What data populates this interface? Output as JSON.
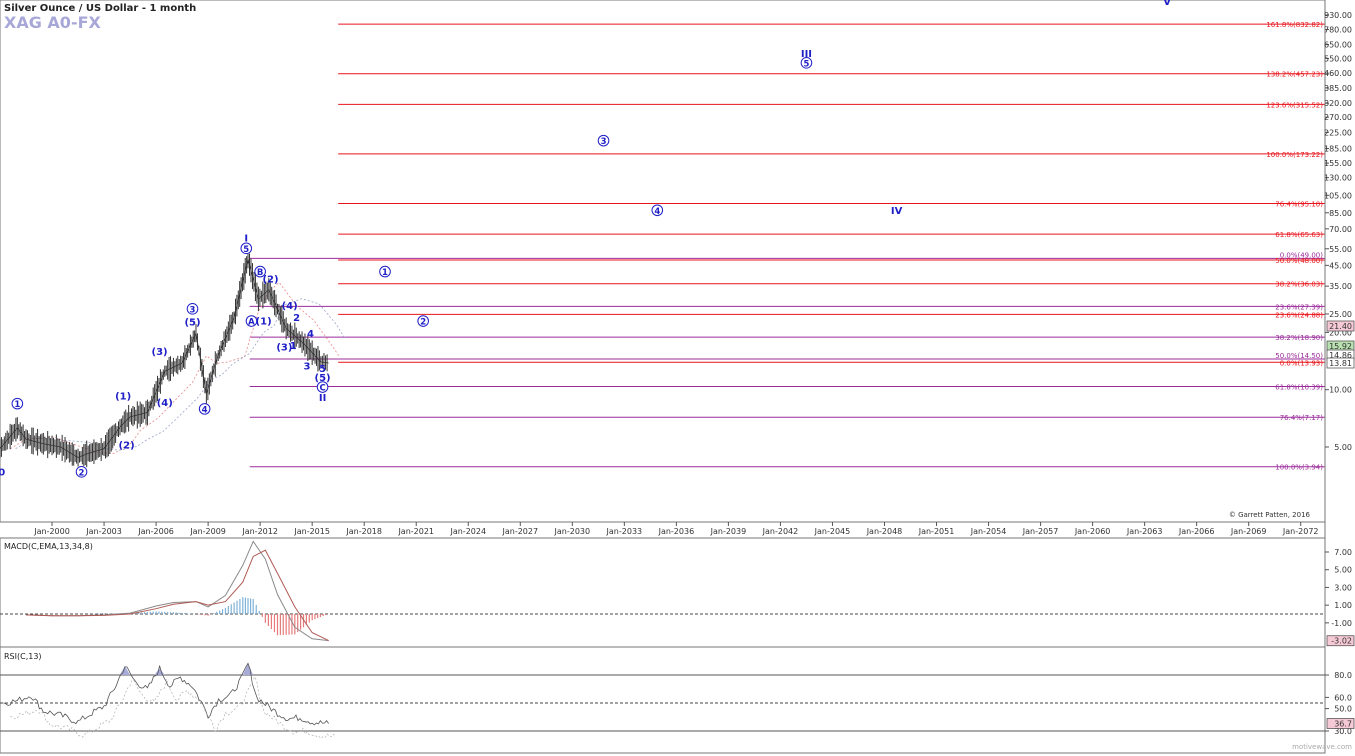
{
  "header": {
    "title": "Silver Ounce / US Dollar - 1 month",
    "symbol": "XAG A0-FX"
  },
  "copyright": "© Garrett Patten, 2016",
  "watermark": "motivewave.com",
  "colors": {
    "price": "#333333",
    "wave_label": "#1f1fc8",
    "fib_red": "#e8141b",
    "fib_purple": "#9b2b9b",
    "macd_line": "#8a8a8a",
    "signal_line": "#b05a55",
    "hist_pos": "#7fb2d8",
    "hist_neg": "#e67a7a",
    "rsi": "#555555"
  },
  "chart_data": [
    {
      "type": "line",
      "name": "price",
      "y_scale": "log",
      "y_ticks": [
        "930.00",
        "780.00",
        "650.00",
        "550.00",
        "460.00",
        "385.00",
        "320.00",
        "270.00",
        "225.00",
        "185.00",
        "155.00",
        "130.00",
        "105.00",
        "85.00",
        "70.00",
        "55.00",
        "45.00",
        "35.00",
        "25.00",
        "20.00",
        "10.00",
        "5.00"
      ],
      "x_ticks": [
        "Jan-2000",
        "Jan-2003",
        "Jan-2006",
        "Jan-2009",
        "Jan-2012",
        "Jan-2015",
        "Jan-2018",
        "Jan-2021",
        "Jan-2024",
        "Jan-2027",
        "Jan-2030",
        "Jan-2033",
        "Jan-2036",
        "Jan-2039",
        "Jan-2042",
        "Jan-2045",
        "Jan-2048",
        "Jan-2051",
        "Jan-2054",
        "Jan-2057",
        "Jan-2060",
        "Jan-2063",
        "Jan-2066",
        "Jan-2069",
        "Jan-2072"
      ],
      "price_badges": [
        {
          "label": "21.40",
          "value": 21.4,
          "style": "pink"
        },
        {
          "label": "15.92",
          "value": 15.92,
          "style": "green"
        },
        {
          "label": "14.86",
          "value": 14.86,
          "style": "white"
        },
        {
          "label": "13.81",
          "value": 13.81,
          "style": "white"
        }
      ],
      "series": [
        {
          "x": [
            1997.0,
            1998.0,
            1998.5,
            1999.5,
            2000.5,
            2001.5,
            2002.0,
            2003.0,
            2004.0,
            2004.5,
            2005.5,
            2006.5,
            2007.5,
            2008.3,
            2008.9,
            2009.5,
            2010.5,
            2011.3,
            2011.9,
            2012.5,
            2013.5,
            2014.5,
            2015.5,
            2015.95
          ],
          "values": [
            4.9,
            6.3,
            5.5,
            5.2,
            5.0,
            4.4,
            4.6,
            4.9,
            6.5,
            7.2,
            7.6,
            12.5,
            13.8,
            19.8,
            9.5,
            14.5,
            24.0,
            48.6,
            30.0,
            33.5,
            21.0,
            17.5,
            14.0,
            13.81
          ]
        }
      ],
      "fib_levels": [
        {
          "label": "161.8%(832.82)",
          "value": 832.82,
          "color": "red"
        },
        {
          "label": "138.2%(457.23)",
          "value": 457.23,
          "color": "red"
        },
        {
          "label": "123.6%(315.52)",
          "value": 315.52,
          "color": "red"
        },
        {
          "label": "100.0%(173.22)",
          "value": 173.22,
          "color": "red"
        },
        {
          "label": "76.4%(95.10)",
          "value": 95.1,
          "color": "red"
        },
        {
          "label": "61.8%(65.63)",
          "value": 65.63,
          "color": "red"
        },
        {
          "label": "0.0%(49.00)",
          "value": 49.0,
          "color": "purple"
        },
        {
          "label": "50.0%(48.00)",
          "value": 48.0,
          "color": "red"
        },
        {
          "label": "38.2%(36.03)",
          "value": 36.03,
          "color": "red"
        },
        {
          "label": "23.6%(27.39)",
          "value": 27.39,
          "color": "purple"
        },
        {
          "label": "23.6%(24.88)",
          "value": 24.88,
          "color": "red"
        },
        {
          "label": "38.2%(18.90)",
          "value": 18.9,
          "color": "purple"
        },
        {
          "label": "50.0%(14.50)",
          "value": 14.5,
          "color": "purple"
        },
        {
          "label": "0.0%(13.93)",
          "value": 13.93,
          "color": "red"
        },
        {
          "label": "61.8%(10.39)",
          "value": 10.39,
          "color": "purple"
        },
        {
          "label": "76.4%(7.17)",
          "value": 7.17,
          "color": "purple"
        },
        {
          "label": "100.0%(3.94)",
          "value": 3.94,
          "color": "purple"
        }
      ],
      "wave_labels": [
        {
          "text": "0",
          "x": 1997.1,
          "y": 3.55,
          "circle": false
        },
        {
          "text": "1",
          "x": 1998.0,
          "y": 8.1,
          "circle": true
        },
        {
          "text": "2",
          "x": 2001.7,
          "y": 3.55,
          "circle": true
        },
        {
          "text": "(1)",
          "x": 2004.1,
          "y": 8.9,
          "circle": false
        },
        {
          "text": "(2)",
          "x": 2004.3,
          "y": 4.9,
          "circle": false
        },
        {
          "text": "(3)",
          "x": 2006.2,
          "y": 15.2,
          "circle": false
        },
        {
          "text": "(4)",
          "x": 2006.5,
          "y": 8.2,
          "circle": false
        },
        {
          "text": "3",
          "x": 2008.1,
          "y": 25.5,
          "circle": true
        },
        {
          "text": "(5)",
          "x": 2008.1,
          "y": 21.8,
          "circle": false
        },
        {
          "text": "4",
          "x": 2008.8,
          "y": 7.6,
          "circle": true
        },
        {
          "text": "I",
          "x": 2011.2,
          "y": 60.0,
          "circle": false
        },
        {
          "text": "5",
          "x": 2011.2,
          "y": 53.0,
          "circle": true
        },
        {
          "text": "B",
          "x": 2012.0,
          "y": 40.0,
          "circle": true,
          "letter": true
        },
        {
          "text": "(2)",
          "x": 2012.6,
          "y": 36.5,
          "circle": false
        },
        {
          "text": "A",
          "x": 2011.5,
          "y": 22.0,
          "circle": true,
          "letter": true
        },
        {
          "text": "(1)",
          "x": 2012.2,
          "y": 22.0,
          "circle": false
        },
        {
          "text": "(4)",
          "x": 2013.7,
          "y": 26.5,
          "circle": false
        },
        {
          "text": "2",
          "x": 2014.1,
          "y": 23.0,
          "circle": false
        },
        {
          "text": "4",
          "x": 2014.9,
          "y": 18.9,
          "circle": false
        },
        {
          "text": "(3)",
          "x": 2013.4,
          "y": 16.1,
          "circle": false
        },
        {
          "text": "1",
          "x": 2013.9,
          "y": 16.4,
          "circle": false
        },
        {
          "text": "3",
          "x": 2014.7,
          "y": 12.8,
          "circle": false
        },
        {
          "text": "5",
          "x": 2015.6,
          "y": 12.4,
          "circle": false
        },
        {
          "text": "(5)",
          "x": 2015.6,
          "y": 11.1,
          "circle": false
        },
        {
          "text": "C",
          "x": 2015.6,
          "y": 9.9,
          "circle": true,
          "letter": true
        },
        {
          "text": "II",
          "x": 2015.6,
          "y": 8.7,
          "circle": false
        },
        {
          "text": "1",
          "x": 2019.2,
          "y": 40.0,
          "circle": true
        },
        {
          "text": "2",
          "x": 2021.4,
          "y": 22.0,
          "circle": true
        },
        {
          "text": "3",
          "x": 2031.8,
          "y": 195.0,
          "circle": true
        },
        {
          "text": "4",
          "x": 2034.9,
          "y": 84.0,
          "circle": true
        },
        {
          "text": "III",
          "x": 2043.5,
          "y": 560.0,
          "circle": false
        },
        {
          "text": "5",
          "x": 2043.5,
          "y": 500.0,
          "circle": true
        },
        {
          "text": "IV",
          "x": 2048.7,
          "y": 84.0,
          "circle": false
        },
        {
          "text": "V",
          "x": 2064.3,
          "y": 1050.0,
          "circle": false
        }
      ]
    },
    {
      "type": "line",
      "name": "MACD(C,EMA,13,34,8)",
      "y_ticks": [
        "7.00",
        "5.00",
        "3.00",
        "1.00",
        "-1.00"
      ],
      "badge": "-3.02",
      "series": [
        {
          "name": "macd",
          "x": [
            1998.5,
            2000,
            2001.5,
            2003,
            2004.5,
            2006,
            2007,
            2008.3,
            2009,
            2010,
            2011,
            2011.6,
            2012.3,
            2013,
            2014,
            2015,
            2015.95
          ],
          "values": [
            -0.1,
            -0.2,
            -0.2,
            -0.1,
            0.1,
            0.9,
            1.3,
            1.4,
            0.8,
            2.1,
            5.5,
            8.2,
            6.2,
            2.2,
            -1.5,
            -2.8,
            -3.0
          ]
        },
        {
          "name": "signal",
          "x": [
            1998.5,
            2000,
            2001.5,
            2003,
            2004.5,
            2006,
            2007,
            2008.3,
            2009,
            2010,
            2011,
            2011.6,
            2012.3,
            2013,
            2014,
            2015,
            2015.95
          ],
          "values": [
            -0.1,
            -0.2,
            -0.2,
            -0.15,
            0.0,
            0.6,
            1.1,
            1.4,
            1.0,
            1.4,
            3.6,
            6.5,
            7.2,
            4.6,
            0.8,
            -2.1,
            -3.0
          ]
        }
      ]
    },
    {
      "type": "line",
      "name": "RSI(C,13)",
      "y_ticks": [
        "80.0",
        "60.0",
        "50.0",
        "30.0"
      ],
      "badge": "36.7",
      "series": [
        {
          "name": "rsi",
          "x": [
            1997.2,
            1998,
            1998.8,
            1999.5,
            2000.5,
            2001.5,
            2002.3,
            2003,
            2003.6,
            2004.2,
            2004.8,
            2005.5,
            2006.2,
            2006.8,
            2007.4,
            2008.1,
            2008.6,
            2009,
            2009.6,
            2010.3,
            2010.9,
            2011.3,
            2011.8,
            2012.3,
            2013,
            2013.6,
            2014.3,
            2015,
            2015.95
          ],
          "values": [
            55,
            57,
            62,
            48,
            44,
            38,
            46,
            52,
            68,
            88,
            74,
            67,
            86,
            70,
            78,
            70,
            56,
            44,
            58,
            62,
            76,
            90,
            60,
            54,
            46,
            41,
            42,
            38,
            36.7
          ]
        }
      ]
    }
  ]
}
